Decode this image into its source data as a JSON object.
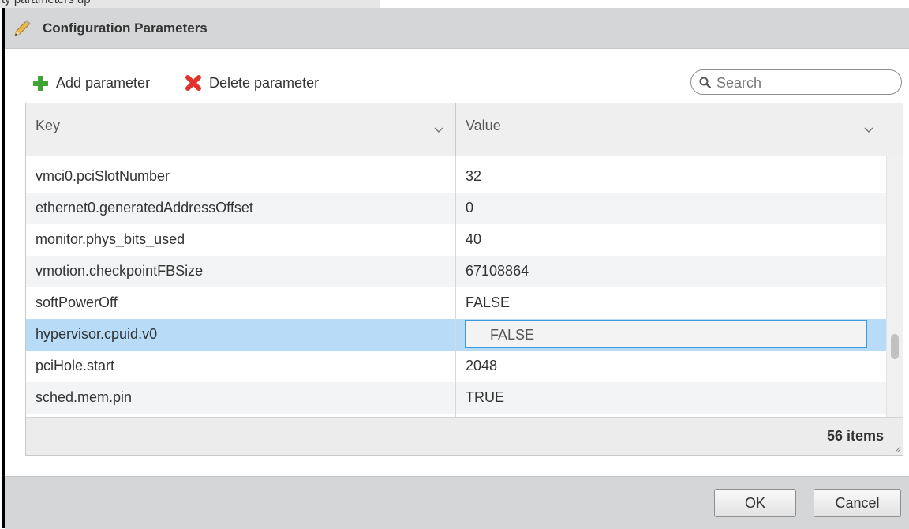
{
  "background_window": {
    "partial_text": "ty parameters up"
  },
  "dialog": {
    "title": "Configuration Parameters",
    "title_icon": "pencil-icon"
  },
  "toolbar": {
    "add_label": "Add parameter",
    "add_icon": "plus-icon",
    "delete_label": "Delete parameter",
    "delete_icon": "x-icon"
  },
  "search": {
    "placeholder": "Search",
    "value": ""
  },
  "grid": {
    "columns": [
      {
        "label": "Key"
      },
      {
        "label": "Value"
      }
    ],
    "rows": [
      {
        "key": "vmci0.pciSlotNumber",
        "value": "32"
      },
      {
        "key": "ethernet0.generatedAddressOffset",
        "value": "0"
      },
      {
        "key": "monitor.phys_bits_used",
        "value": "40"
      },
      {
        "key": "vmotion.checkpointFBSize",
        "value": "67108864"
      },
      {
        "key": "softPowerOff",
        "value": "FALSE"
      },
      {
        "key": "hypervisor.cpuid.v0",
        "value": "FALSE",
        "selected": true,
        "editing": true
      },
      {
        "key": "pciHole.start",
        "value": "2048"
      },
      {
        "key": "sched.mem.pin",
        "value": "TRUE"
      }
    ],
    "item_count": "56 items"
  },
  "buttons": {
    "ok": "OK",
    "cancel": "Cancel"
  },
  "colors": {
    "title_bar": "#d4d6d8",
    "selected_row": "#b8dcf8",
    "edit_border": "#3d9be0",
    "add_icon": "#3ea534",
    "delete_icon": "#e0332b"
  }
}
